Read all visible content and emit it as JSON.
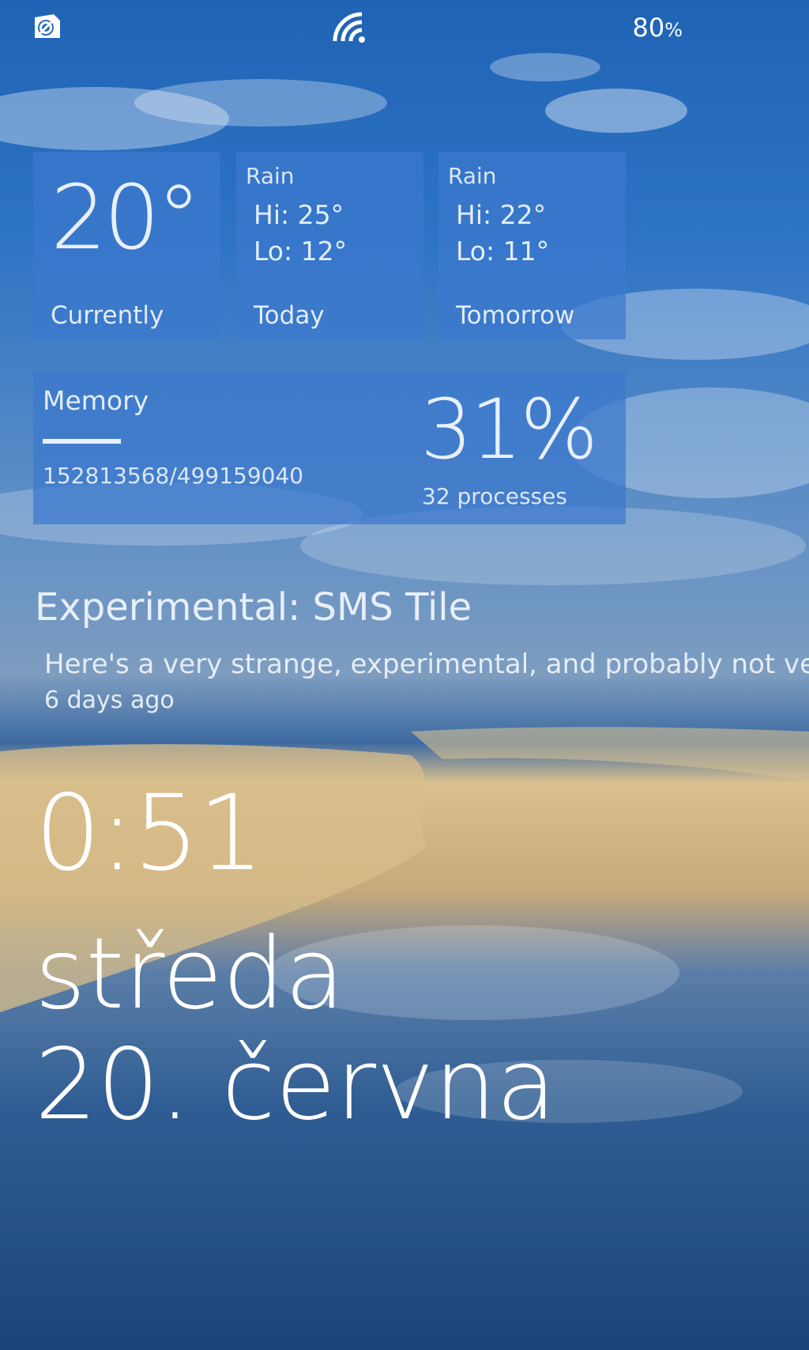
{
  "status_bar": {
    "battery_number": "80",
    "battery_unit": "%",
    "icons": [
      "notification-icon",
      "wifi-icon"
    ]
  },
  "weather": {
    "current": {
      "temperature": "20°",
      "label": "Currently"
    },
    "today": {
      "condition": "Rain",
      "hi": "Hi: 25°",
      "lo": "Lo: 12°",
      "label": "Today"
    },
    "tomorrow": {
      "condition": "Rain",
      "hi": "Hi: 22°",
      "lo": "Lo: 11°",
      "label": "Tomorrow"
    }
  },
  "memory": {
    "title": "Memory",
    "bytes": "152813568/499159040",
    "percent": "31%",
    "percent_value": 0.31,
    "processes": "32 processes"
  },
  "sms_tile": {
    "title": "Experimental: SMS Tile",
    "body": "Here's a very strange, experimental, and probably not ver",
    "time": "6 days ago"
  },
  "lock": {
    "time": "0:51",
    "day": "středa",
    "date": "20. června"
  },
  "colors": {
    "tile_background": "#3c78cd",
    "text": "#ffffff"
  }
}
